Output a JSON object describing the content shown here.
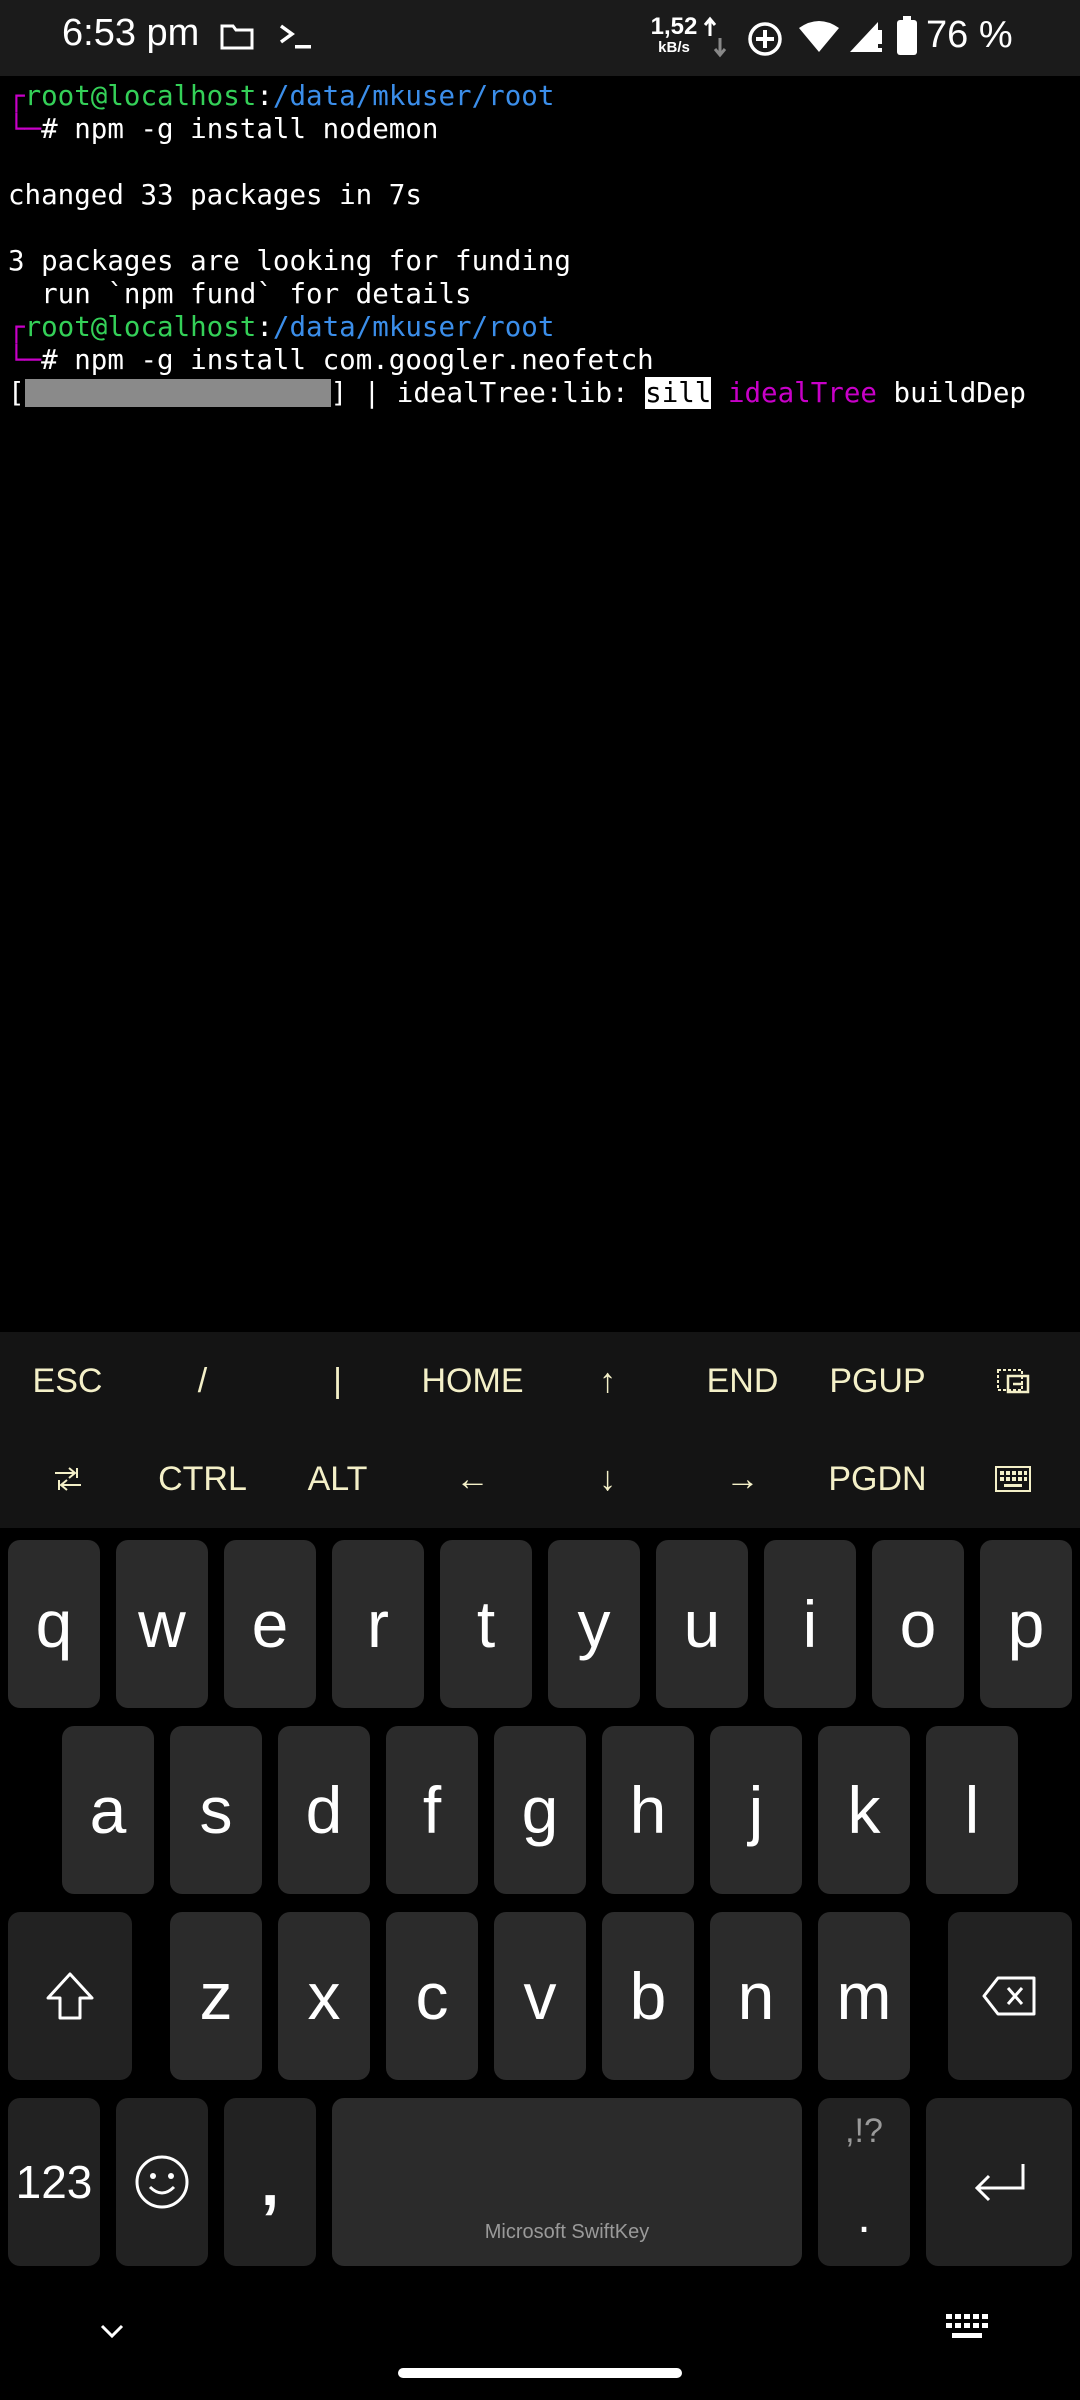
{
  "status_bar": {
    "time": "6:53 pm",
    "net_speed": "1,52",
    "net_unit": "kB/s",
    "battery": "76 %",
    "icons": [
      "folder-icon",
      "terminal-prompt-icon",
      "data-arrows-icon",
      "sync-icon",
      "wifi-icon",
      "signal-icon",
      "battery-icon"
    ]
  },
  "terminal": {
    "prompt_user": "root@localhost",
    "prompt_sep": ":",
    "prompt_path": "/data/mkuser/root",
    "cmd1": "# npm -g install nodemon",
    "out1": "changed 33 packages in 7s",
    "out2": "3 packages are looking for funding",
    "out3": "  run `npm fund` for details",
    "cmd2": "# npm -g install com.googler.neofetch",
    "progress_prefix": "[",
    "progress_suffix": "] | idealTree:lib: ",
    "progress_level": "sill",
    "progress_tag": "idealTree",
    "progress_msg": "buildDep"
  },
  "extra_keys": {
    "row1": [
      "ESC",
      "/",
      "|",
      "HOME",
      "↑",
      "END",
      "PGUP"
    ],
    "row2": [
      "CTRL",
      "ALT",
      "←",
      "↓",
      "→",
      "PGDN"
    ],
    "color": "#f4f0c8"
  },
  "keyboard": {
    "row1": [
      "q",
      "w",
      "e",
      "r",
      "t",
      "y",
      "u",
      "i",
      "o",
      "p"
    ],
    "row2": [
      "a",
      "s",
      "d",
      "f",
      "g",
      "h",
      "j",
      "k",
      "l"
    ],
    "row3": [
      "z",
      "x",
      "c",
      "v",
      "b",
      "n",
      "m"
    ],
    "numbers_label": "123",
    "comma": ",",
    "space_label": "Microsoft SwiftKey",
    "punct_top": ",!?",
    "punct_main": "."
  },
  "colors": {
    "prompt_green": "#34d058",
    "path_blue": "#3b8eea",
    "accent_purple": "#c800c8",
    "key_bg": "#2b2b2b"
  }
}
